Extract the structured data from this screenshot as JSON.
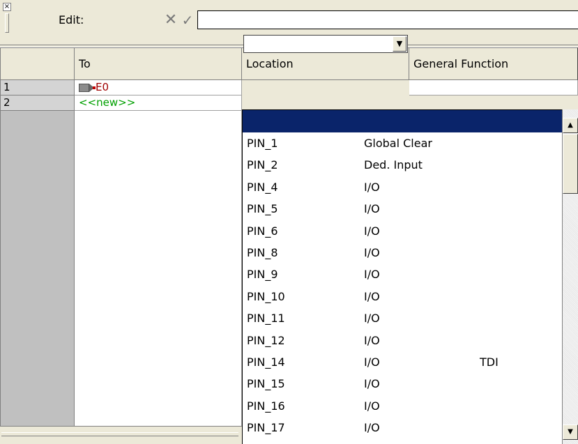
{
  "edit_bar": {
    "close_glyph": "×",
    "label": "Edit:",
    "cancel_glyph": "✕",
    "accept_glyph": "✓",
    "value": ""
  },
  "grid": {
    "columns": [
      "To",
      "Location",
      "General Function"
    ],
    "rows": [
      {
        "number": "1",
        "to": "E0",
        "location": "",
        "general_function": ""
      },
      {
        "number": "2",
        "to": "<<new>>",
        "location": "",
        "general_function": ""
      }
    ]
  },
  "location_dropdown": {
    "arrow": "▼",
    "selected": "",
    "options": [
      {
        "pin": "PIN_1",
        "function": "Global Clear",
        "special": ""
      },
      {
        "pin": "PIN_2",
        "function": "Ded. Input",
        "special": ""
      },
      {
        "pin": "PIN_4",
        "function": "I/O",
        "special": ""
      },
      {
        "pin": "PIN_5",
        "function": "I/O",
        "special": ""
      },
      {
        "pin": "PIN_6",
        "function": "I/O",
        "special": ""
      },
      {
        "pin": "PIN_8",
        "function": "I/O",
        "special": ""
      },
      {
        "pin": "PIN_9",
        "function": "I/O",
        "special": ""
      },
      {
        "pin": "PIN_10",
        "function": "I/O",
        "special": ""
      },
      {
        "pin": "PIN_11",
        "function": "I/O",
        "special": ""
      },
      {
        "pin": "PIN_12",
        "function": "I/O",
        "special": ""
      },
      {
        "pin": "PIN_14",
        "function": "I/O",
        "special": "TDI"
      },
      {
        "pin": "PIN_15",
        "function": "I/O",
        "special": ""
      },
      {
        "pin": "PIN_16",
        "function": "I/O",
        "special": ""
      },
      {
        "pin": "PIN_17",
        "function": "I/O",
        "special": ""
      }
    ]
  },
  "scrollbar": {
    "up_arrow": "▲",
    "down_arrow": "▼"
  },
  "colors": {
    "selection": "#0a246a",
    "new_row": "#00a000",
    "node_name": "#a00000"
  }
}
